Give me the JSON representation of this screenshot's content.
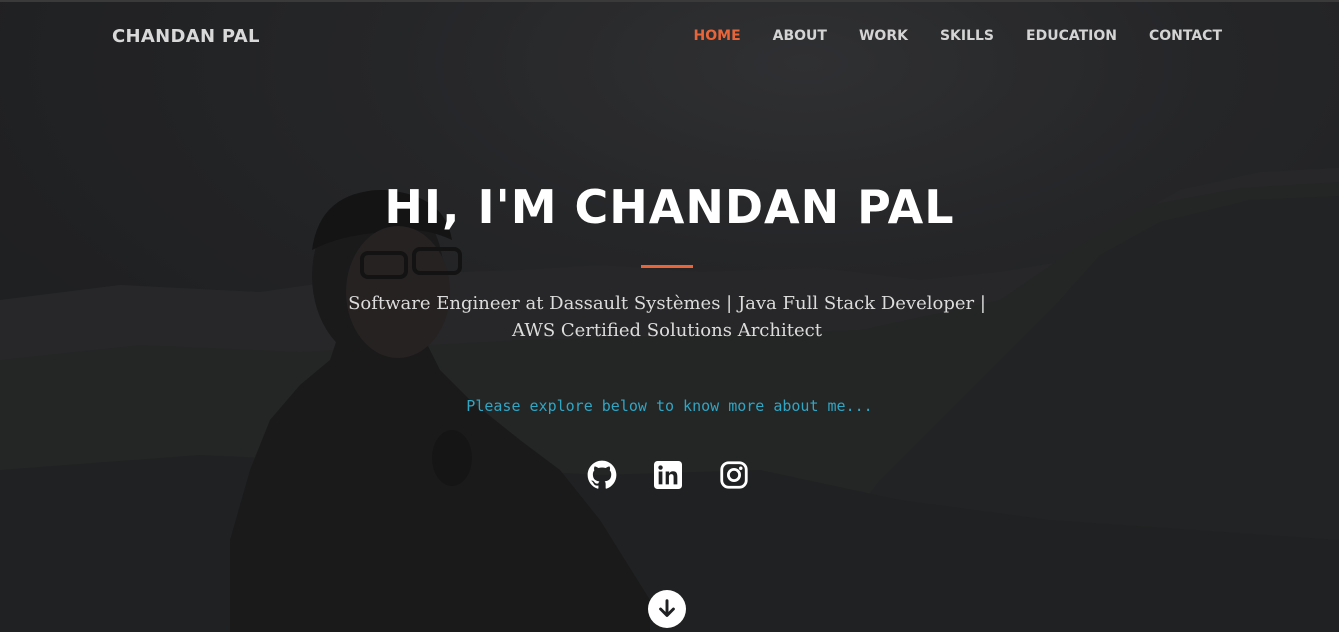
{
  "brand": {
    "name": "CHANDAN PAL"
  },
  "nav": {
    "items": [
      {
        "label": "HOME",
        "active": true
      },
      {
        "label": "ABOUT",
        "active": false
      },
      {
        "label": "WORK",
        "active": false
      },
      {
        "label": "SKILLS",
        "active": false
      },
      {
        "label": "EDUCATION",
        "active": false
      },
      {
        "label": "CONTACT",
        "active": false
      }
    ]
  },
  "hero": {
    "title": "HI, I'M CHANDAN PAL",
    "subtitle": "Software Engineer at Dassault Systèmes | Java Full Stack Developer | AWS Certified Solutions Architect",
    "explore_text": "Please explore below to know more about me..."
  },
  "socials": {
    "icons": [
      "github-icon",
      "linkedin-icon",
      "instagram-icon"
    ]
  },
  "scroll": {
    "icon": "arrow-down-icon"
  },
  "colors": {
    "accent": "#e8653a",
    "explore_text": "#2fa6c4",
    "background": "#2a2b2e",
    "nav_text": "#d4d4d4"
  }
}
